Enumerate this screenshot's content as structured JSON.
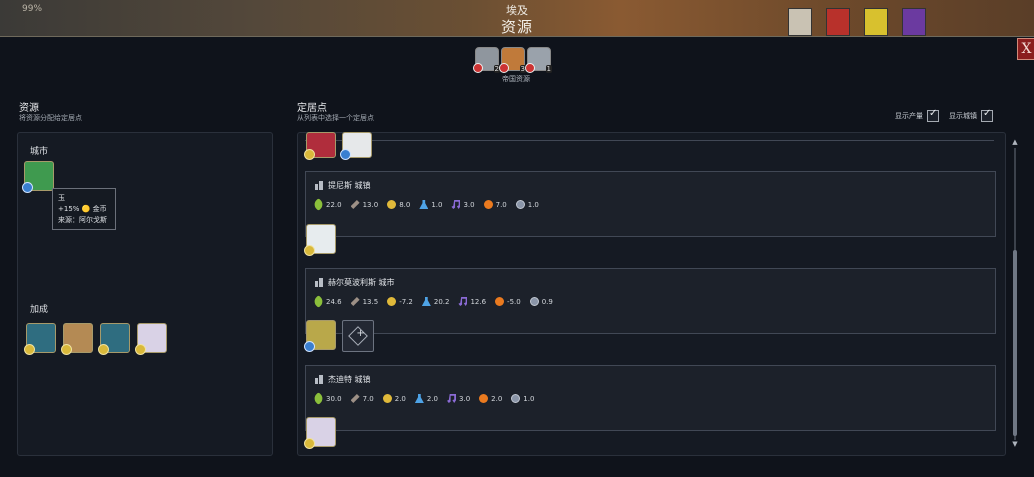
{
  "top": {
    "pct": "99%",
    "country": "埃及",
    "title": "资源"
  },
  "colors": {
    "panel": "#151a23",
    "card": "#1c212a",
    "close": "#8b1e1e"
  },
  "empire_resources": {
    "label": "帝国资源",
    "items": [
      {
        "count": "2",
        "icon": "statue-icon"
      },
      {
        "count": "3",
        "icon": "warrior-icon"
      },
      {
        "count": "1",
        "icon": "helmet-icon"
      }
    ]
  },
  "left": {
    "title": "资源",
    "subtitle": "将资源分配给定居点",
    "city_label": "城市",
    "tooltip": {
      "line1": "玉",
      "line2": "+15% 🟡 金币",
      "line3": "来源：阿尔戈斯"
    },
    "bonus_label": "加成"
  },
  "right": {
    "title": "定居点",
    "subtitle": "从列表中选择一个定居点",
    "show_output": "显示产量",
    "show_towns": "显示城镇"
  },
  "settlements": [
    {
      "name": "提尼斯 城镇",
      "yields": [
        "22.0",
        "13.0",
        "8.0",
        "1.0",
        "3.0",
        "7.0",
        "1.0"
      ]
    },
    {
      "name": "赫尔莫波利斯 城市",
      "yields": [
        "24.6",
        "13.5",
        "-7.2",
        "20.2",
        "12.6",
        "-5.0",
        "0.9"
      ]
    },
    {
      "name": "杰迪特 城镇",
      "yields": [
        "30.0",
        "7.0",
        "2.0",
        "2.0",
        "3.0",
        "2.0",
        "1.0"
      ]
    }
  ]
}
